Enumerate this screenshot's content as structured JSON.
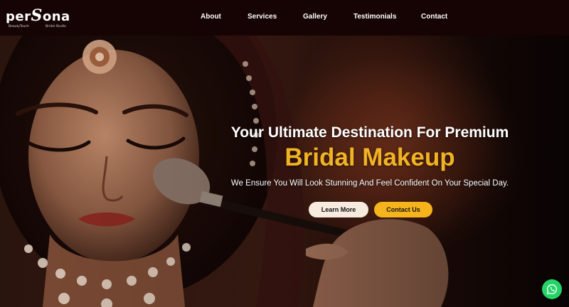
{
  "brand": {
    "name_pre": "per",
    "name_accent": "S",
    "name_post": "ona",
    "sub_left": "BeautyTouch",
    "sub_right": "Bridal Studio"
  },
  "nav": {
    "items": [
      "About",
      "Services",
      "Gallery",
      "Testimonials",
      "Contact"
    ]
  },
  "hero": {
    "headline": "Your Ultimate Destination For Premium",
    "headline_accent": "Bridal Makeup",
    "tagline": "We Ensure You Will Look Stunning And Feel Confident On Your Special Day.",
    "learn_more_label": "Learn More",
    "contact_us_label": "Contact Us"
  },
  "floating": {
    "whatsapp_icon": "whatsapp-icon"
  },
  "colors": {
    "header_bg": "#160303",
    "accent": "#f0b323",
    "contact_button": "#f5b41c",
    "learn_button": "#f7ebe0",
    "whatsapp": "#25d366"
  }
}
